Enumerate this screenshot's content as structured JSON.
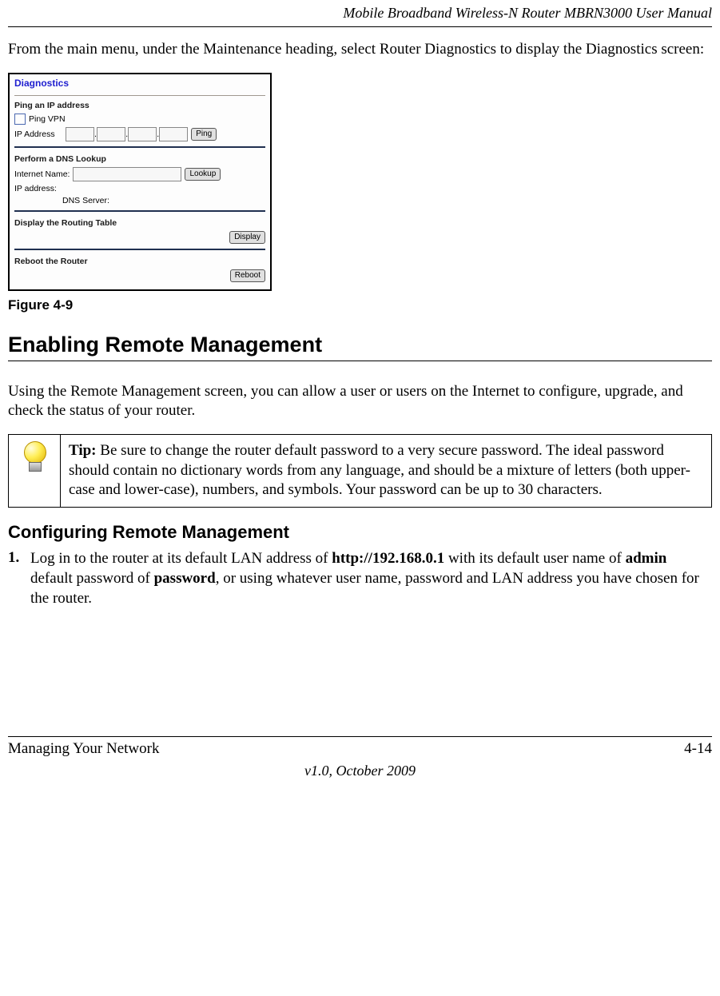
{
  "running_header": "Mobile Broadband Wireless-N Router MBRN3000 User Manual",
  "intro_paragraph": "From the main menu, under the Maintenance heading, select Router Diagnostics to display the Diagnostics screen:",
  "diagnostics_panel": {
    "title": "Diagnostics",
    "ping_section": {
      "heading": "Ping an IP address",
      "checkbox_label": "Ping VPN",
      "ip_label": "IP Address",
      "ping_button": "Ping"
    },
    "dns_section": {
      "heading": "Perform a DNS Lookup",
      "internet_name_label": "Internet Name:",
      "lookup_button": "Lookup",
      "ip_address_label": "IP address:",
      "dns_server_label": "DNS Server:"
    },
    "routing_section": {
      "heading": "Display the Routing Table",
      "display_button": "Display"
    },
    "reboot_section": {
      "heading": "Reboot the Router",
      "reboot_button": "Reboot"
    }
  },
  "figure_caption": "Figure 4-9",
  "section_heading": "Enabling Remote Management",
  "section_paragraph": "Using the Remote Management screen, you can allow a user or users on the Internet to configure, upgrade, and check the status of your router.",
  "tip": {
    "label": "Tip:",
    "text": " Be sure to change the router default password to a very secure password. The ideal password should contain no dictionary words from any language, and should be a mixture of letters (both upper-case and lower-case), numbers, and symbols. Your password can be up to 30 characters."
  },
  "subsection_heading": "Configuring Remote Management",
  "step1": {
    "num": "1.",
    "prefix": "Log in to the router at its default LAN address of ",
    "bold1": "http://192.168.0.1",
    "mid1": " with its default user name of ",
    "bold2": "admin",
    "mid2": " default password of ",
    "bold3": "password",
    "suffix": ", or using whatever user name, password and LAN address you have chosen for the router."
  },
  "footer": {
    "left": "Managing Your Network",
    "right": "4-14",
    "center": "v1.0, October 2009"
  }
}
